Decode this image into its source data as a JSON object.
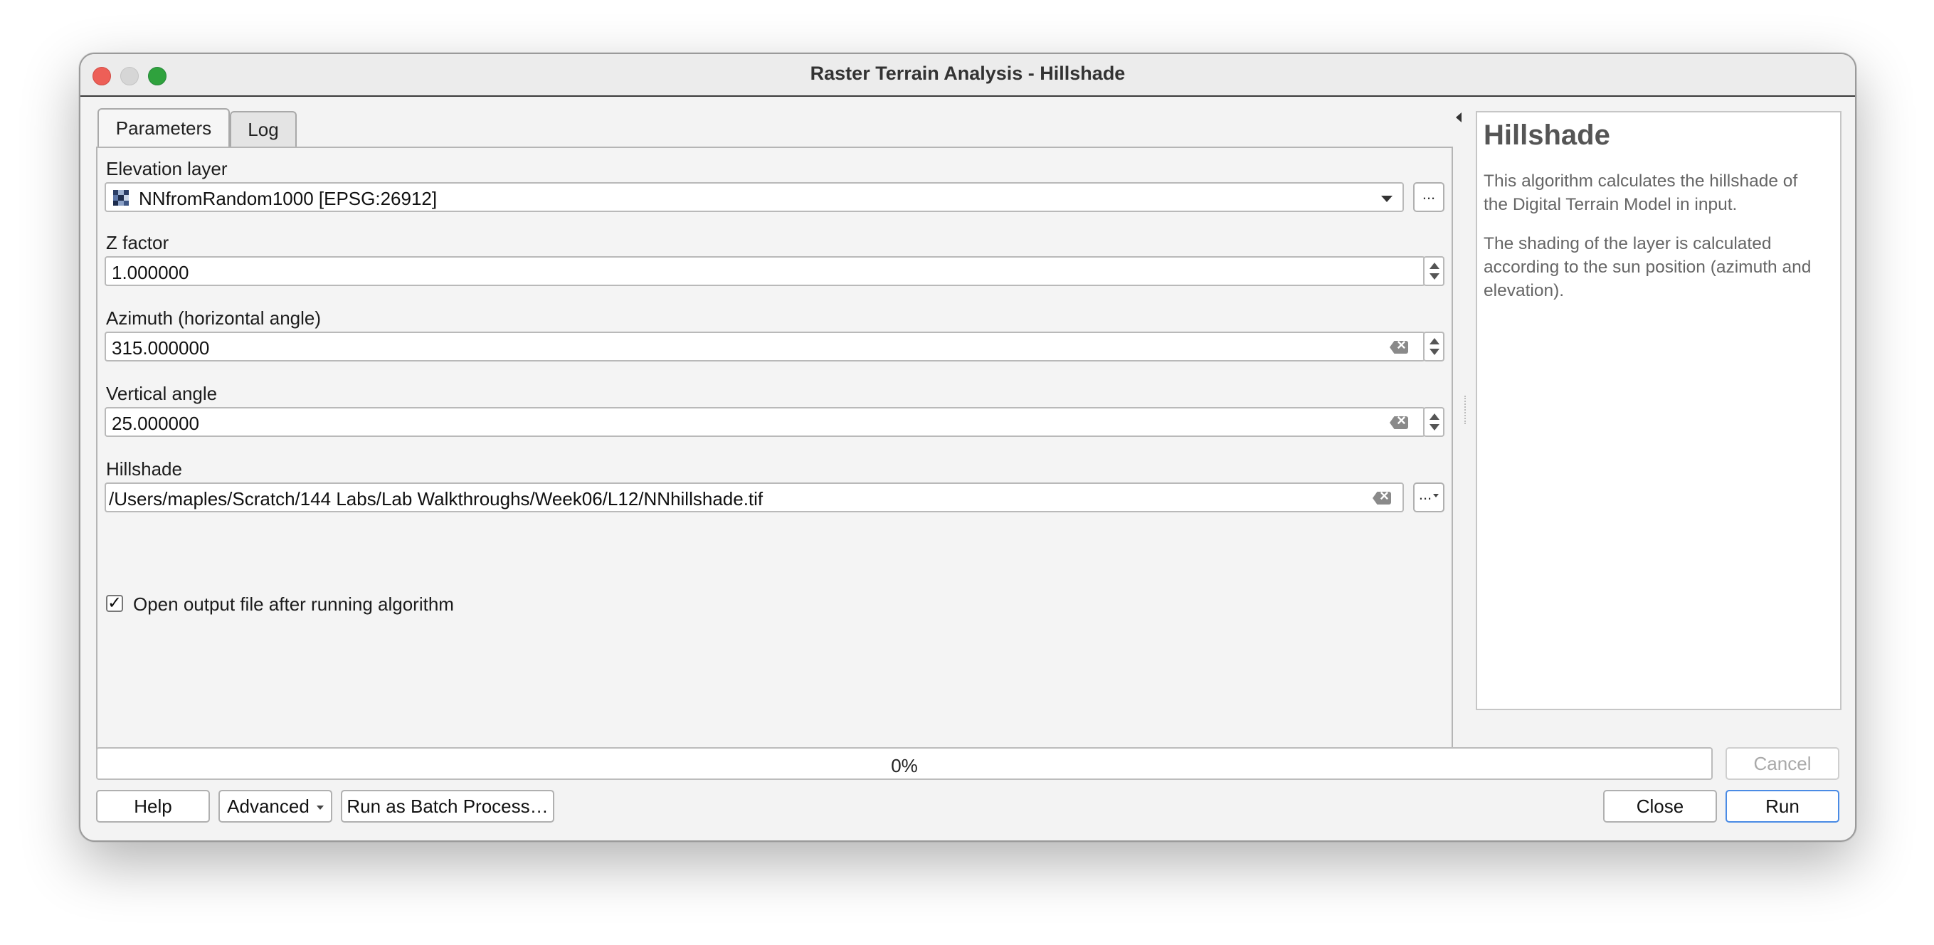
{
  "window": {
    "title": "Raster Terrain Analysis - Hillshade"
  },
  "tabs": [
    {
      "label": "Parameters"
    },
    {
      "label": "Log"
    }
  ],
  "params": {
    "elevation": {
      "label": "Elevation layer",
      "value": "NNfromRandom1000 [EPSG:26912]",
      "browse": "..."
    },
    "zfactor": {
      "label": "Z factor",
      "value": "1.000000"
    },
    "azimuth": {
      "label": "Azimuth (horizontal angle)",
      "value": "315.000000"
    },
    "vertical": {
      "label": "Vertical angle",
      "value": "25.000000"
    },
    "hillshade": {
      "label": "Hillshade",
      "value": "/Users/maples/Scratch/144 Labs/Lab Walkthroughs/Week06/L12/NNhillshade.tif",
      "browse": "..."
    },
    "open_output": {
      "label": "Open output file after running algorithm",
      "checked": true,
      "mark": "✓"
    }
  },
  "help": {
    "title": "Hillshade",
    "p1": "This algorithm calculates the hillshade of the Digital Terrain Model in input.",
    "p2": "The shading of the layer is calculated according to the sun position (azimuth and elevation)."
  },
  "progress": {
    "value": 0,
    "text": "0%"
  },
  "buttons": {
    "cancel": "Cancel",
    "help": "Help",
    "advanced": "Advanced",
    "batch": "Run as Batch Process…",
    "close": "Close",
    "run": "Run"
  },
  "colors": {
    "close": "#ed5f57",
    "minimize": "#d6d6d6",
    "maximize": "#2fa23d",
    "accent": "#4a8be5"
  }
}
